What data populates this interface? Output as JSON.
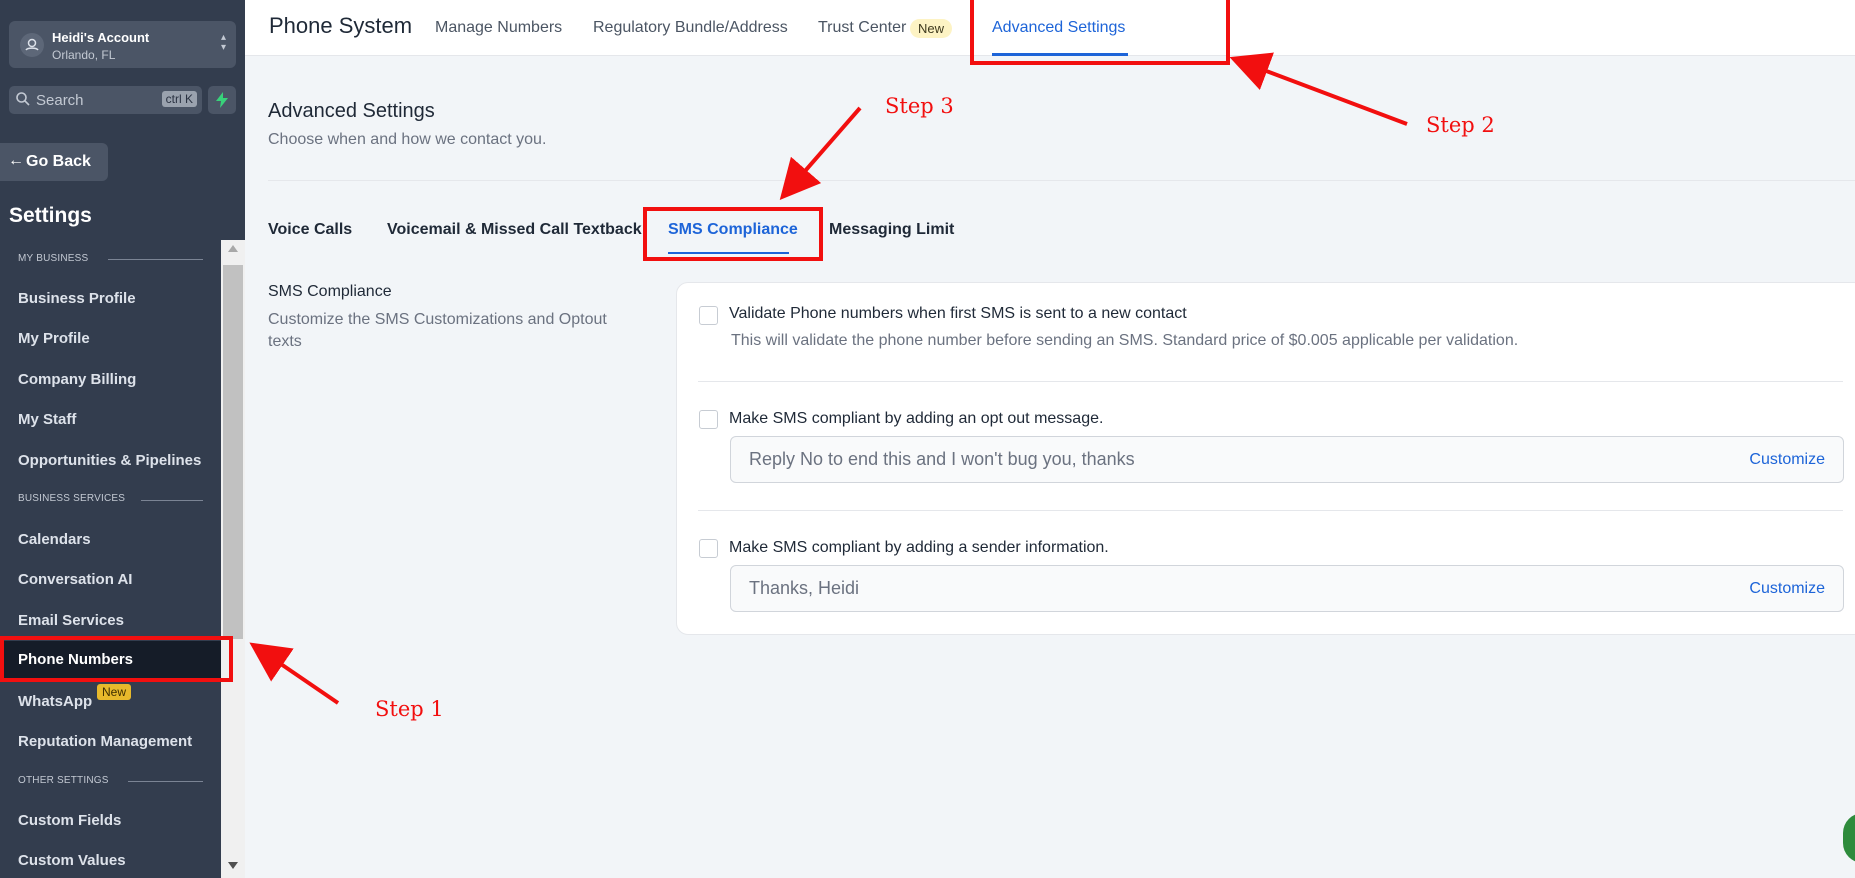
{
  "account": {
    "name": "Heidi's Account",
    "location": "Orlando, FL"
  },
  "search": {
    "placeholder": "Search",
    "shortcut": "ctrl K"
  },
  "sidebar": {
    "go_back": "Go Back",
    "title": "Settings",
    "sections": [
      {
        "label": "MY BUSINESS"
      },
      {
        "label": "BUSINESS SERVICES"
      },
      {
        "label": "OTHER SETTINGS"
      }
    ],
    "items": [
      {
        "label": "Business Profile"
      },
      {
        "label": "My Profile"
      },
      {
        "label": "Company Billing"
      },
      {
        "label": "My Staff"
      },
      {
        "label": "Opportunities & Pipelines"
      },
      {
        "label": "Calendars"
      },
      {
        "label": "Conversation AI"
      },
      {
        "label": "Email Services"
      },
      {
        "label": "Phone Numbers",
        "active": true
      },
      {
        "label": "WhatsApp",
        "badge": "New"
      },
      {
        "label": "Reputation Management"
      },
      {
        "label": "Custom Fields"
      },
      {
        "label": "Custom Values"
      }
    ]
  },
  "topbar": {
    "title": "Phone System",
    "tabs": [
      {
        "label": "Manage Numbers"
      },
      {
        "label": "Regulatory Bundle/Address"
      },
      {
        "label": "Trust Center",
        "badge": "New"
      },
      {
        "label": "Advanced Settings",
        "active": true
      }
    ]
  },
  "content": {
    "title": "Advanced Settings",
    "subtitle": "Choose when and how we contact you.",
    "tabs": [
      {
        "label": "Voice Calls"
      },
      {
        "label": "Voicemail & Missed Call Textback"
      },
      {
        "label": "SMS Compliance",
        "active": true
      },
      {
        "label": "Messaging Limit"
      }
    ],
    "section": {
      "title": "SMS Compliance",
      "description": "Customize the SMS Customizations and Optout texts"
    },
    "options": [
      {
        "label": "Validate Phone numbers when first SMS is sent to a new contact",
        "help": "This will validate the phone number before sending an SMS. Standard price of $0.005 applicable per validation.",
        "checked": false
      },
      {
        "label": "Make SMS compliant by adding an opt out message.",
        "input_value": "Reply No to end this and I won't bug you, thanks",
        "button": "Customize",
        "checked": false
      },
      {
        "label": "Make SMS compliant by adding a sender information.",
        "input_value": "Thanks, Heidi",
        "button": "Customize",
        "checked": false
      }
    ]
  },
  "annotations": {
    "step1": "Step 1",
    "step2": "Step 2",
    "step3": "Step 3",
    "color": "#f20f0f"
  },
  "colors": {
    "sidebar": "#333d4e",
    "accent": "#1d64d8",
    "badge": "#e7b92b"
  }
}
